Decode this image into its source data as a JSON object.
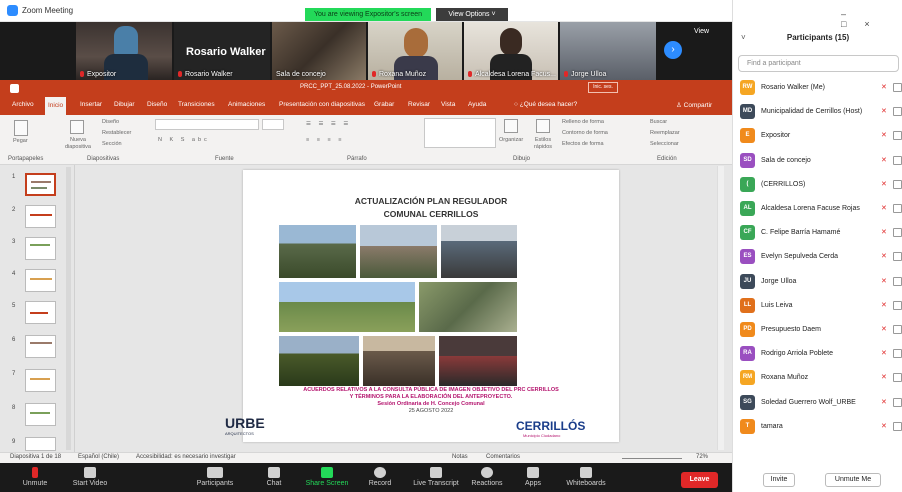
{
  "window": {
    "title": "Zoom Meeting",
    "viewing_banner": "You are viewing Expositor's screen",
    "view_options": "View Options ˅"
  },
  "video_strip": {
    "speaker_name": "Rosario Walker",
    "tiles": [
      {
        "label": "Expositor"
      },
      {
        "label": "Rosario Walker"
      },
      {
        "label": "Sala de concejo"
      },
      {
        "label": "Roxana Muñoz"
      },
      {
        "label": "Alcaldesa Lorena Facus..."
      },
      {
        "label": "Jorge Ulloa"
      }
    ],
    "view_label": "View"
  },
  "powerpoint": {
    "file_title": "PRCC_PPT_25.08.2022 - PowerPoint",
    "sign_in": "Inic. ses.",
    "tabs": [
      "Archivo",
      "Inicio",
      "Insertar",
      "Dibujar",
      "Diseño",
      "Transiciones",
      "Animaciones",
      "Presentación con diapositivas",
      "Grabar",
      "Revisar",
      "Vista",
      "Ayuda"
    ],
    "tell_me": "¿Qué desea hacer?",
    "share": "Compartir",
    "ribbon": {
      "groups": [
        "Portapapeles",
        "Diapositivas",
        "Fuente",
        "Párrafo",
        "Dibujo",
        "Edición"
      ],
      "paste": "Pegar",
      "new_slide": "Nueva diapositiva",
      "design": "Diseño",
      "reset": "Restablecer",
      "section": "Sección",
      "organize": "Organizar",
      "quick_styles": "Estilos rápidos",
      "shape_fill": "Relleno de forma",
      "shape_outline": "Contorno de forma",
      "shape_effects": "Efectos de forma",
      "find": "Buscar",
      "replace": "Reemplazar",
      "select": "Seleccionar"
    },
    "thumb_numbers": [
      "1",
      "2",
      "3",
      "4",
      "5",
      "6",
      "7",
      "8",
      "9"
    ],
    "slide": {
      "title_line1": "ACTUALIZACIÓN PLAN REGULADOR",
      "title_line2": "COMUNAL CERRILLOS",
      "agreement_line1": "ACUERDOS RELATIVOS A LA CONSULTA PÚBLICA DE IMAGEN OBJETIVO DEL PRC CERRILLOS",
      "agreement_line2": "Y TÉRMINOS PARA LA ELABORACIÓN DEL ANTEPROYECTO.",
      "agreement_line3": "Sesión Ordinaria de H. Concejo Comunal",
      "agreement_line4": "25 AGOSTO 2022",
      "logo_left": "URBE",
      "logo_left_sub": "ARQUITECTOS",
      "logo_right": "CERRILLÓS",
      "logo_right_sub": "Municipio Ciudadano"
    },
    "status": {
      "slide_count": "Diapositiva 1 de 18",
      "language": "Español (Chile)",
      "accessibility": "Accesibilidad: es necesario investigar",
      "notes": "Notas",
      "comments": "Comentarios",
      "zoom": "72%"
    }
  },
  "toolbar": {
    "unmute": "Unmute",
    "start_video": "Start Video",
    "participants": "Participants",
    "participants_count": "15",
    "chat": "Chat",
    "share_screen": "Share Screen",
    "record": "Record",
    "live_transcript": "Live Transcript",
    "reactions": "Reactions",
    "apps": "Apps",
    "whiteboards": "Whiteboards",
    "leave": "Leave"
  },
  "participants": {
    "title": "Participants (15)",
    "search_placeholder": "Find a participant",
    "list": [
      {
        "initials": "RW",
        "name": "Rosario Walker (Me)",
        "color": "#f5a623"
      },
      {
        "initials": "MD",
        "name": "Municipalidad de Cerrillos (Host)",
        "color": "#3d4a5a"
      },
      {
        "initials": "E",
        "name": "Expositor",
        "color": "#f08a1c"
      },
      {
        "initials": "SD",
        "name": "Sala de concejo",
        "color": "#9a4fc0"
      },
      {
        "initials": "(",
        "name": "(CERRILLOS)",
        "color": "#3aa757"
      },
      {
        "initials": "AL",
        "name": "Alcaldesa Lorena Facuse Rojas",
        "color": "#3aa757"
      },
      {
        "initials": "CF",
        "name": "C. Felipe Barría Hamamé",
        "color": "#3aa757"
      },
      {
        "initials": "ES",
        "name": "Evelyn Sepulveda Cerda",
        "color": "#9a4fc0"
      },
      {
        "initials": "JU",
        "name": "Jorge Ulloa",
        "color": "#3d4a5a"
      },
      {
        "initials": "LL",
        "name": "Luis Leiva",
        "color": "#e0701c"
      },
      {
        "initials": "PD",
        "name": "Presupuesto Daem",
        "color": "#f08a1c"
      },
      {
        "initials": "RA",
        "name": "Rodrigo Arriola Poblete",
        "color": "#9a4fc0"
      },
      {
        "initials": "RM",
        "name": "Roxana Muñoz",
        "color": "#f5a623"
      },
      {
        "initials": "SG",
        "name": "Soledad Guerrero Wolf_URBE",
        "color": "#3d4a5a"
      },
      {
        "initials": "T",
        "name": "tamara",
        "color": "#f08a1c"
      }
    ],
    "invite": "Invite",
    "unmute_me": "Unmute Me"
  }
}
